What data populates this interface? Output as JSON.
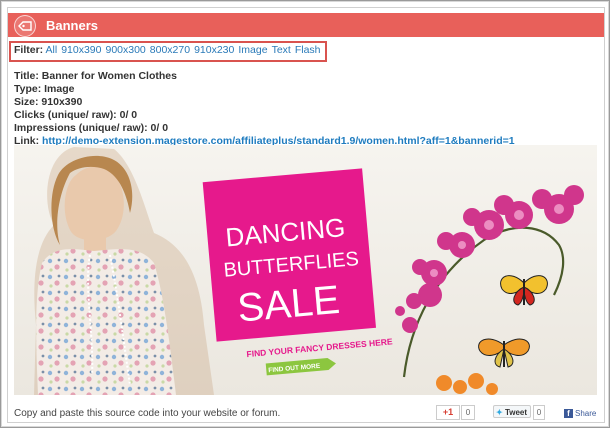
{
  "header": {
    "title": "Banners",
    "icon": "tag-arrow-icon",
    "color": "#e8605a"
  },
  "filter": {
    "label": "Filter:",
    "options": [
      "All",
      "910x390",
      "900x300",
      "800x270",
      "910x230",
      "Image",
      "Text",
      "Flash"
    ]
  },
  "banner_info": {
    "title": "Title: Banner for Women Clothes",
    "type": "Type: Image",
    "size": "Size: 910x390",
    "clicks": "Clicks (unique/ raw): 0/ 0",
    "impressions": "Impressions (unique/ raw): 0/ 0",
    "link_label": "Link:",
    "link_url": "http://demo-extension.magestore.com/affiliateplus/standard1.9/women.html?aff=1&bannerid=1"
  },
  "banner_image": {
    "line1": "DANCING",
    "line2": "BUTTERFLIES",
    "line3": "SALE",
    "tagline": "FIND YOUR FANCY DRESSES HERE",
    "cta": "FIND OUT MORE",
    "colors": {
      "pink": "#e6198c",
      "green": "#8cc63f",
      "orchid": "#d0368c"
    }
  },
  "footer": {
    "copy_text": "Copy and paste this source code into your website or forum.",
    "gplus_label": "+1",
    "gplus_count": "0",
    "tweet_label": "Tweet",
    "tweet_count": "0",
    "share_label": "Share"
  }
}
